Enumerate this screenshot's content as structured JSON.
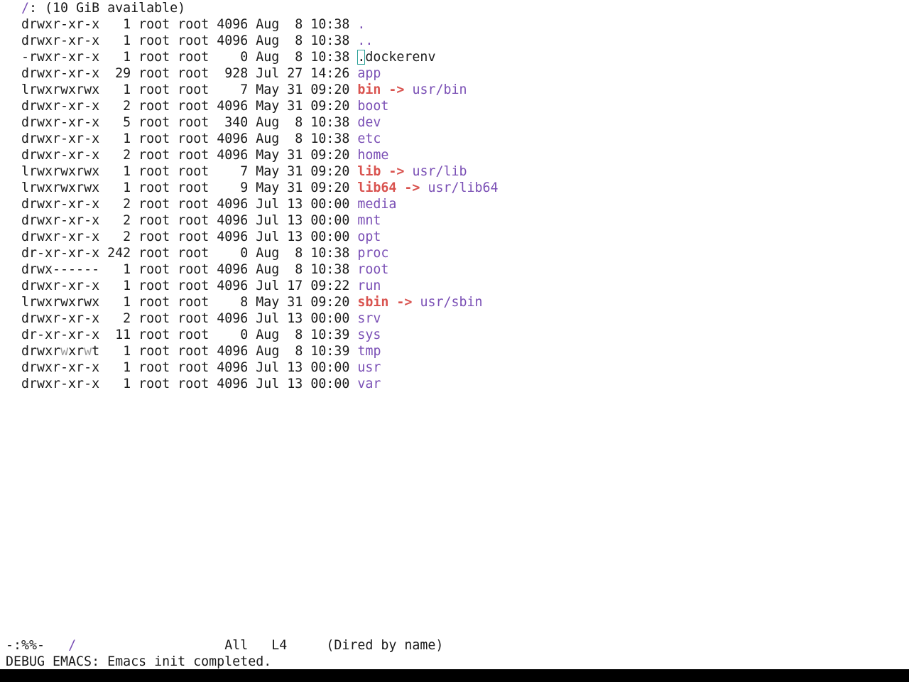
{
  "header": {
    "path": "/",
    "suffix": ": (10 GiB available)"
  },
  "entries": [
    {
      "perms": "drwxr-xr-x",
      "links": "1",
      "owner": "root",
      "group": "root",
      "size": "4096",
      "date": "Aug  8 10:38",
      "name": ".",
      "type": "dir"
    },
    {
      "perms": "drwxr-xr-x",
      "links": "1",
      "owner": "root",
      "group": "root",
      "size": "4096",
      "date": "Aug  8 10:38",
      "name": "..",
      "type": "dir"
    },
    {
      "perms": "-rwxr-xr-x",
      "links": "1",
      "owner": "root",
      "group": "root",
      "size": "0",
      "date": "Aug  8 10:38",
      "name": ".dockerenv",
      "type": "file"
    },
    {
      "perms": "drwxr-xr-x",
      "links": "29",
      "owner": "root",
      "group": "root",
      "size": "928",
      "date": "Jul 27 14:26",
      "name": "app",
      "type": "dir"
    },
    {
      "perms": "lrwxrwxrwx",
      "links": "1",
      "owner": "root",
      "group": "root",
      "size": "7",
      "date": "May 31 09:20",
      "name": "bin",
      "type": "link",
      "target": "usr/bin"
    },
    {
      "perms": "drwxr-xr-x",
      "links": "2",
      "owner": "root",
      "group": "root",
      "size": "4096",
      "date": "May 31 09:20",
      "name": "boot",
      "type": "dir"
    },
    {
      "perms": "drwxr-xr-x",
      "links": "5",
      "owner": "root",
      "group": "root",
      "size": "340",
      "date": "Aug  8 10:38",
      "name": "dev",
      "type": "dir"
    },
    {
      "perms": "drwxr-xr-x",
      "links": "1",
      "owner": "root",
      "group": "root",
      "size": "4096",
      "date": "Aug  8 10:38",
      "name": "etc",
      "type": "dir"
    },
    {
      "perms": "drwxr-xr-x",
      "links": "2",
      "owner": "root",
      "group": "root",
      "size": "4096",
      "date": "May 31 09:20",
      "name": "home",
      "type": "dir"
    },
    {
      "perms": "lrwxrwxrwx",
      "links": "1",
      "owner": "root",
      "group": "root",
      "size": "7",
      "date": "May 31 09:20",
      "name": "lib",
      "type": "link",
      "target": "usr/lib"
    },
    {
      "perms": "lrwxrwxrwx",
      "links": "1",
      "owner": "root",
      "group": "root",
      "size": "9",
      "date": "May 31 09:20",
      "name": "lib64",
      "type": "link",
      "target": "usr/lib64"
    },
    {
      "perms": "drwxr-xr-x",
      "links": "2",
      "owner": "root",
      "group": "root",
      "size": "4096",
      "date": "Jul 13 00:00",
      "name": "media",
      "type": "dir"
    },
    {
      "perms": "drwxr-xr-x",
      "links": "2",
      "owner": "root",
      "group": "root",
      "size": "4096",
      "date": "Jul 13 00:00",
      "name": "mnt",
      "type": "dir"
    },
    {
      "perms": "drwxr-xr-x",
      "links": "2",
      "owner": "root",
      "group": "root",
      "size": "4096",
      "date": "Jul 13 00:00",
      "name": "opt",
      "type": "dir"
    },
    {
      "perms": "dr-xr-xr-x",
      "links": "242",
      "owner": "root",
      "group": "root",
      "size": "0",
      "date": "Aug  8 10:38",
      "name": "proc",
      "type": "dir"
    },
    {
      "perms": "drwx------",
      "links": "1",
      "owner": "root",
      "group": "root",
      "size": "4096",
      "date": "Aug  8 10:38",
      "name": "root",
      "type": "dir"
    },
    {
      "perms": "drwxr-xr-x",
      "links": "1",
      "owner": "root",
      "group": "root",
      "size": "4096",
      "date": "Jul 17 09:22",
      "name": "run",
      "type": "dir"
    },
    {
      "perms": "lrwxrwxrwx",
      "links": "1",
      "owner": "root",
      "group": "root",
      "size": "8",
      "date": "May 31 09:20",
      "name": "sbin",
      "type": "link",
      "target": "usr/sbin"
    },
    {
      "perms": "drwxr-xr-x",
      "links": "2",
      "owner": "root",
      "group": "root",
      "size": "4096",
      "date": "Jul 13 00:00",
      "name": "srv",
      "type": "dir"
    },
    {
      "perms": "dr-xr-xr-x",
      "links": "11",
      "owner": "root",
      "group": "root",
      "size": "0",
      "date": "Aug  8 10:39",
      "name": "sys",
      "type": "dir"
    },
    {
      "perms": "drwxrwxrwt",
      "links": "1",
      "owner": "root",
      "group": "root",
      "size": "4096",
      "date": "Aug  8 10:39",
      "name": "tmp",
      "type": "dir"
    },
    {
      "perms": "drwxr-xr-x",
      "links": "1",
      "owner": "root",
      "group": "root",
      "size": "4096",
      "date": "Jul 13 00:00",
      "name": "usr",
      "type": "dir"
    },
    {
      "perms": "drwxr-xr-x",
      "links": "1",
      "owner": "root",
      "group": "root",
      "size": "4096",
      "date": "Jul 13 00:00",
      "name": "var",
      "type": "dir"
    }
  ],
  "modeline": {
    "status": "-:%%-",
    "buffer": "/",
    "position": "All",
    "line": "L4",
    "mode": "(Dired by name)"
  },
  "minibuffer": {
    "message": "DEBUG EMACS: Emacs init completed."
  },
  "colors": {
    "directory": "#7a4fb5",
    "symlink": "#d9534f",
    "point_box": "#2aa198"
  }
}
